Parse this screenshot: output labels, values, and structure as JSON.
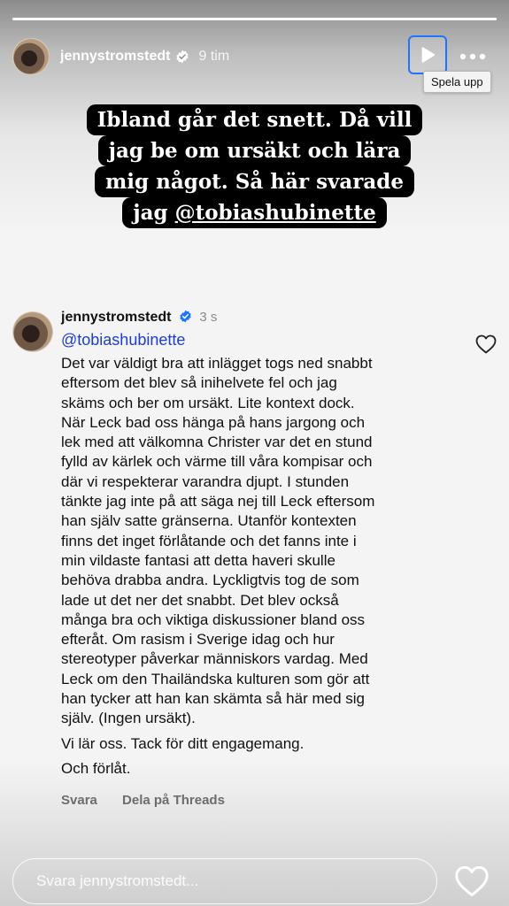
{
  "story": {
    "progress": 1.0,
    "username": "jennystromstedt",
    "time": "9 tim",
    "play_tooltip": "Spela upp"
  },
  "caption": {
    "lines": [
      "Ibland går det snett. Då vill",
      "jag be om ursäkt och lära",
      "mig något. Så här svarade"
    ],
    "last_line_prefix": "jag ",
    "mention": "@tobiashubinette"
  },
  "comment": {
    "username": "jennystromstedt",
    "time": "3 s",
    "mention": "@tobiashubinette",
    "text": "Det var väldigt bra att inlägget togs ned snabbt\neftersom det blev så inihelvete fel och jag\nskäms och ber om ursäkt. Lite kontext dock.\nNär Leck bad oss hänga på hans jargong och\nlek med att välkomna Christer var det en stund\nfylld av kärlek och värme till våra kompisar och\ndär vi respekterar varandra djupt. I stunden\ntänkte jag inte på att säga nej till Leck eftersom\nhan själv satte gränserna. Utanför kontexten\nfinns det inget förlåtande och det fanns inte i\nmin vildaste fantasi att detta haveri skulle\nbehöva drabba andra. Lyckligtvis tog de som\nlade ut det ner det snabbt. Det blev också\nmånga bra och viktiga diskussioner bland oss\nefteråt. Om rasism i Sverige idag och hur\nstereotyper påverkar människors vardag. Med\nLeck om den Thailändska kulturen som gör att\nhan tycker att han kan skämta så här med sig\nsjälv. (Ingen ursäkt).",
    "para2": "Vi lär oss. Tack för ditt engagemang.",
    "para3": "Och förlåt.",
    "reply_label": "Svara",
    "share_label": "Dela på Threads"
  },
  "reply": {
    "placeholder": "Svara jennystromstedt..."
  },
  "colors": {
    "verified": "#1e74ff",
    "mention": "#1e3ec9",
    "focus_border": "#1e74ff"
  },
  "icons": [
    "verified-icon",
    "play-icon",
    "more-icon",
    "heart-icon"
  ]
}
